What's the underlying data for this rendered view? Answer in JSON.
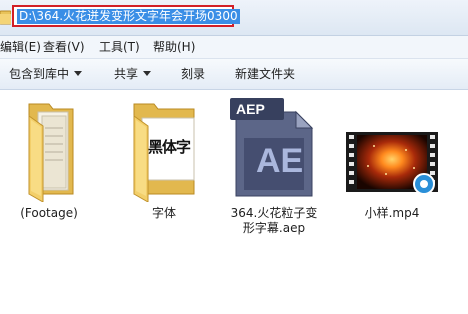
{
  "address_bar": {
    "path": "D:\\364.火花迸发变形文字年会开场0300"
  },
  "menu": {
    "edit": "编辑(E)",
    "view": "查看(V)",
    "tools": "工具(T)",
    "help": "帮助(H)"
  },
  "command_bar": {
    "include_in_library": "包含到库中",
    "share": "共享",
    "burn": "刻录",
    "new_folder": "新建文件夹"
  },
  "files": [
    {
      "name": "(Footage)",
      "type": "folder"
    },
    {
      "name": "字体",
      "type": "folder",
      "preview_text": "黑体字"
    },
    {
      "name_line1": "364.火花粒子变",
      "name_line2": "形字幕.aep",
      "type": "aep",
      "badge": "AEP",
      "logo": "AE"
    },
    {
      "name": "小样.mp4",
      "type": "video"
    }
  ],
  "colors": {
    "highlight_border": "#d21f27",
    "selection": "#3a8ee6",
    "ae_logo_text": "#aab7dd"
  }
}
